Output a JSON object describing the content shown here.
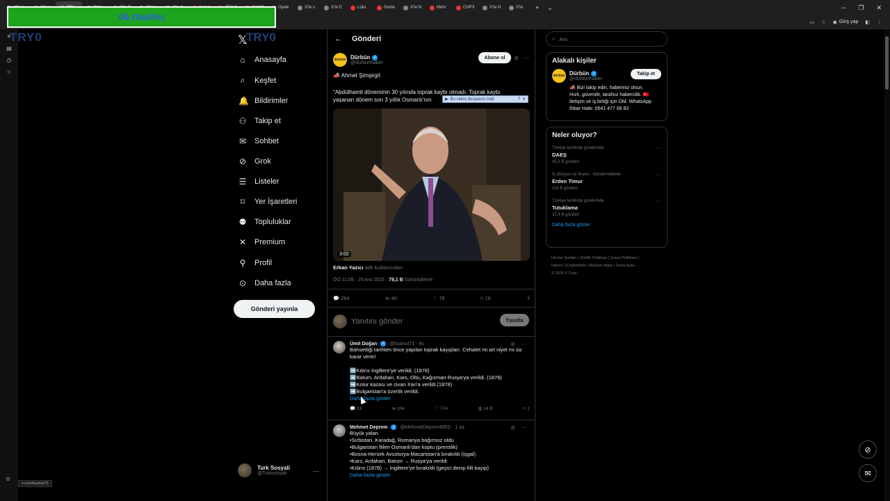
{
  "browser": {
    "tabs": [
      {
        "label": "X'te p",
        "color": "#888"
      },
      {
        "label": "X'te p",
        "color": "#888"
      },
      {
        "label": "X'te",
        "color": "#888",
        "active": true
      },
      {
        "label": "Only",
        "color": "#888"
      },
      {
        "label": "X'te C",
        "color": "#888"
      },
      {
        "label": "X'te !",
        "color": "#888"
      },
      {
        "label": "X'te A",
        "color": "#888"
      },
      {
        "label": "Avrup",
        "color": "#e33"
      },
      {
        "label": "TEK K",
        "color": "#e33"
      },
      {
        "label": "ÇAKIC",
        "color": "#e33"
      },
      {
        "label": "Üyele",
        "color": "#e33"
      },
      {
        "label": "X'te s",
        "color": "#888"
      },
      {
        "label": "X'te E",
        "color": "#888"
      },
      {
        "label": "Lüks",
        "color": "#e33"
      },
      {
        "label": "Gorile",
        "color": "#e33"
      },
      {
        "label": "X'te N",
        "color": "#888"
      },
      {
        "label": "Mehr",
        "color": "#e33"
      },
      {
        "label": "CHP'li",
        "color": "#e33"
      },
      {
        "label": "X'te N",
        "color": "#888"
      },
      {
        "label": "X'te",
        "color": "#888"
      }
    ],
    "new_tab": "+",
    "tab_search": "⌄",
    "signin_label": "Giriş yap",
    "status_url": "x.com/tsumut71"
  },
  "overlay": {
    "price_text": "0₺ (NaN%)",
    "ghost_logo": "TRY0",
    "download_label": "Bu video dosyasını indir"
  },
  "nav": {
    "ghost": "TRY0",
    "items": [
      {
        "label": "Anasayfa",
        "icon": "home-icon"
      },
      {
        "label": "Keşfet",
        "icon": "search-icon"
      },
      {
        "label": "Bildirimler",
        "icon": "bell-icon"
      },
      {
        "label": "Takip et",
        "icon": "follow-icon"
      },
      {
        "label": "Sohbet",
        "icon": "mail-icon"
      },
      {
        "label": "Grok",
        "icon": "grok-icon"
      },
      {
        "label": "Listeler",
        "icon": "list-icon"
      },
      {
        "label": "Yer İşaretleri",
        "icon": "bookmark-icon"
      },
      {
        "label": "Topluluklar",
        "icon": "communities-icon"
      },
      {
        "label": "Premium",
        "icon": "x-icon"
      },
      {
        "label": "Profil",
        "icon": "profile-icon"
      },
      {
        "label": "Daha fazla",
        "icon": "more-icon"
      }
    ],
    "post_button": "Gönderi yayınla",
    "account": {
      "name": "Turk Sosyali",
      "handle": "@Turksosyali"
    }
  },
  "feed": {
    "title": "Gönderi",
    "author": {
      "name": "Dürbün",
      "handle": "@durbunhaber",
      "avatar_text": "dürbün"
    },
    "follow_label": "Abone ol",
    "text_line1": "📣 Ahmet Şimşirgil:",
    "text_line2": "\"Abdülhamit döneminin 30 yılında toprak kaybı olmadı. Toprak kaybı",
    "text_line3": "yaşanan dönem son 3 yıllık Osmanlı'nın",
    "video_duration": "3:02",
    "user_tag": "Erkan Yazıcı",
    "user_tag_suffix": "adlı kullanıcıdan",
    "timestamp": "ÖÖ 11:08 · 29 Ara 2025 ·",
    "views_count": "79,1 B",
    "views_label": "Görüntüleme",
    "actions": {
      "replies": "284",
      "reposts": "40",
      "likes": "78",
      "bookmarks": "18"
    },
    "reply_placeholder": "Yanıtını gönder",
    "reply_button": "Yanıtla",
    "replies": [
      {
        "name": "Ümit Doğan",
        "handle": "@tsumut71 · 8s",
        "lines": [
          "Bahsettiği tarihten önce yapılan toprak kayıpları. Cehalet mi art niyet mi siz",
          "karar verin!",
          "",
          "➡️Kıbrıs İngiltere'ye verildi. (1878)",
          "➡️Batum, Ardahan, Kars, Oltu, Kağızman Rusya'ya verildi. (1878)",
          "➡️Kotur kazası ve civarı İran'a verildi.(1878)",
          "➡️Bulgaristan'a özerlik verildi."
        ],
        "more": "Daha fazla göster",
        "actions": {
          "replies": "23",
          "reposts": "104",
          "likes": "774",
          "views": "14 B"
        }
      },
      {
        "name": "Mehmet Deprem",
        "handle": "@MehmetDepremMED · 1 sa",
        "lines": [
          "Büyük yalan",
          "•Sırbistan, Karadağ, Romanya bağımsız oldu",
          "•Bulgaristan fiilen Osmanlı'dan koptu (prenslik)",
          "•Bosna-Hersek Avusturya-Macaristan'a bırakıldı (işgal)",
          "•Kars, Ardahan, Batum → Rusya'ya verildi",
          "•Kıbrıs (1878) → İngiltere'ye bırakıldı (geçici denip fiili kayıp)"
        ],
        "more": "Daha fazla göster"
      }
    ]
  },
  "right": {
    "search_placeholder": "Ara",
    "related_title": "Alakalı kişiler",
    "related": {
      "name": "Dürbün",
      "handle": "@durbunhaber",
      "follow": "Takip et",
      "bio1": "📣 Bizi takip edin, haberiniz olsun.",
      "bio2": "Hızlı, güvenilir, tarafsız habercilik. 🇹🇷",
      "bio3": "İletişim ve iş birliği için DM. WhatsApp",
      "bio4": "İhbar Hattı: 0541 477 06 82"
    },
    "trends_title": "Neler oluyor?",
    "trends": [
      {
        "category": "Türkiye tarihinde gündemde",
        "title": "DAEŞ",
        "count": "43,3 B gönderi"
      },
      {
        "category": "İş dünyası ve finans · Gündemdekiler",
        "title": "Erden Timur",
        "count": "116 B gönderi"
      },
      {
        "category": "Türkiye tarihinde gündemde",
        "title": "Tutuklama",
        "count": "15,4 B gönderi"
      }
    ],
    "show_more": "Daha fazla göster",
    "footer1": "Hizmet Şartları | Gizlilik Politikası | Çerez Politikası |",
    "footer2": "Imprint | Erişilebilirlik | Reklam bilgisi | Daha fazla ···",
    "footer3": "© 2025 X Corp."
  }
}
